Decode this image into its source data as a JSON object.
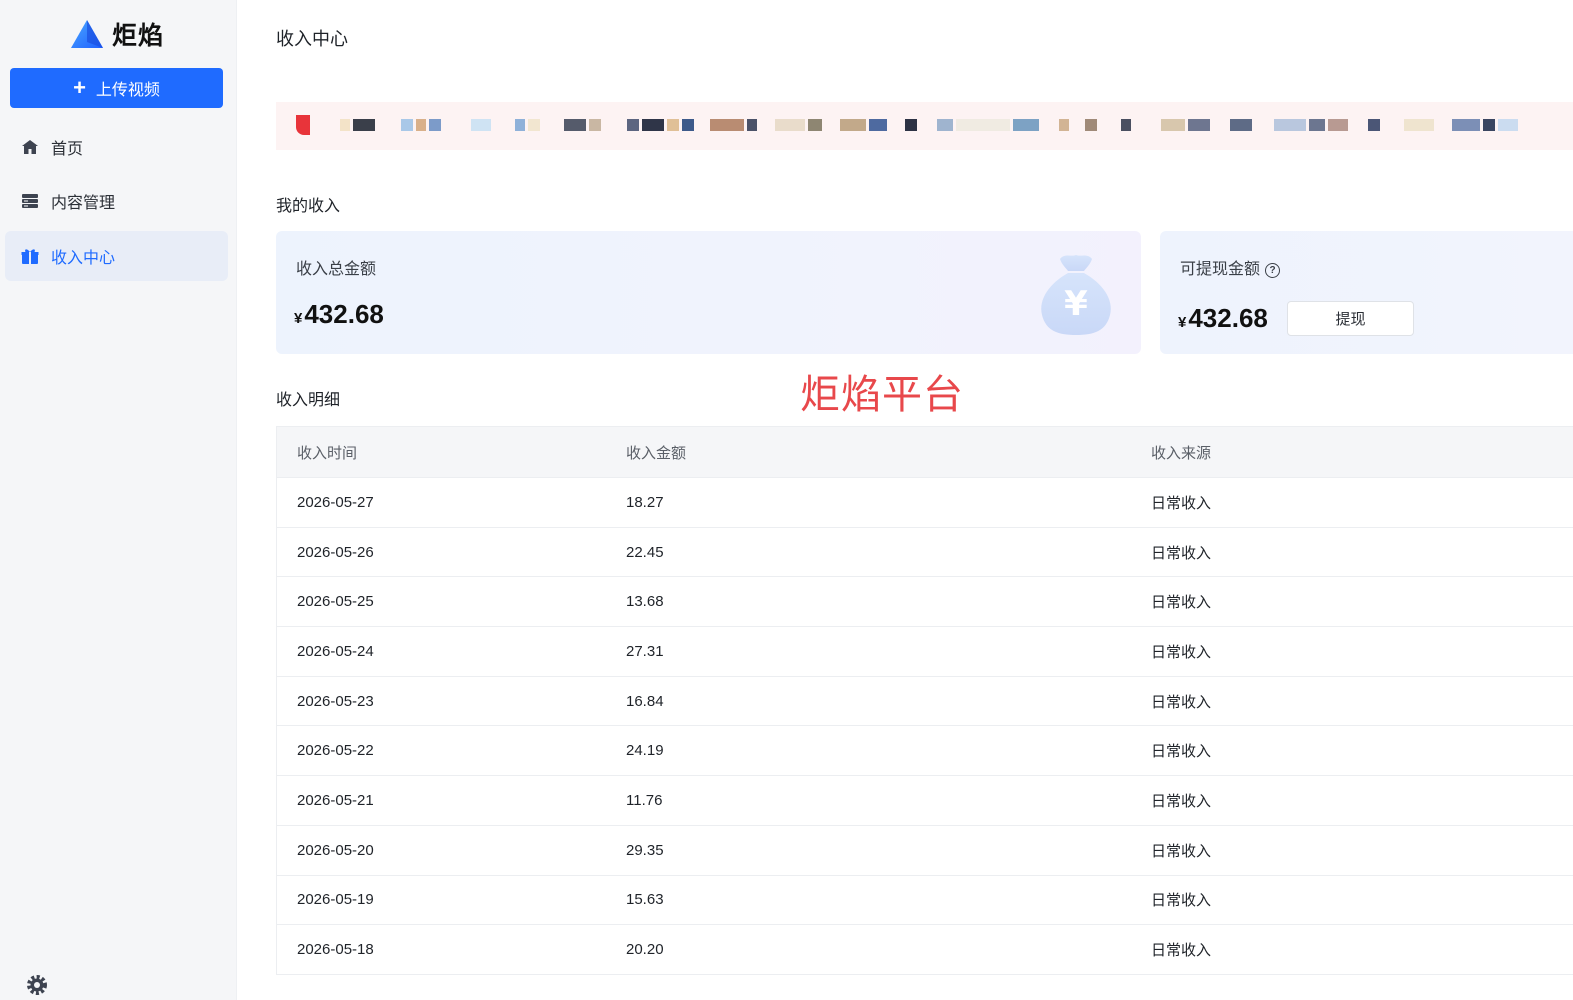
{
  "sidebar": {
    "logo_text": "炬焰",
    "upload_label": "上传视频",
    "items": [
      {
        "label": "首页",
        "icon": "home-icon"
      },
      {
        "label": "内容管理",
        "icon": "storage-icon"
      },
      {
        "label": "收入中心",
        "icon": "gift-icon",
        "active": true
      }
    ]
  },
  "page": {
    "title": "收入中心",
    "my_income_title": "我的收入",
    "detail_title": "收入明细",
    "watermark": "炬焰平台"
  },
  "cards": {
    "total": {
      "label": "收入总金额",
      "currency": "¥",
      "amount": "432.68"
    },
    "withdrawable": {
      "label": "可提现金额",
      "currency": "¥",
      "amount": "432.68",
      "button_label": "提现"
    }
  },
  "table": {
    "headers": [
      "收入时间",
      "收入金额",
      "收入来源"
    ],
    "rows": [
      {
        "date": "2026-05-27",
        "amount": "18.27",
        "source": "日常收入"
      },
      {
        "date": "2026-05-26",
        "amount": "22.45",
        "source": "日常收入"
      },
      {
        "date": "2026-05-25",
        "amount": "13.68",
        "source": "日常收入"
      },
      {
        "date": "2026-05-24",
        "amount": "27.31",
        "source": "日常收入"
      },
      {
        "date": "2026-05-23",
        "amount": "16.84",
        "source": "日常收入"
      },
      {
        "date": "2026-05-22",
        "amount": "24.19",
        "source": "日常收入"
      },
      {
        "date": "2026-05-21",
        "amount": "11.76",
        "source": "日常收入"
      },
      {
        "date": "2026-05-20",
        "amount": "29.35",
        "source": "日常收入"
      },
      {
        "date": "2026-05-19",
        "amount": "15.63",
        "source": "日常收入"
      },
      {
        "date": "2026-05-18",
        "amount": "20.20",
        "source": "日常收入"
      }
    ]
  },
  "colors": {
    "accent": "#1f6bff",
    "watermark": "#e8484b",
    "banner_bg": "#fdf3f3"
  }
}
